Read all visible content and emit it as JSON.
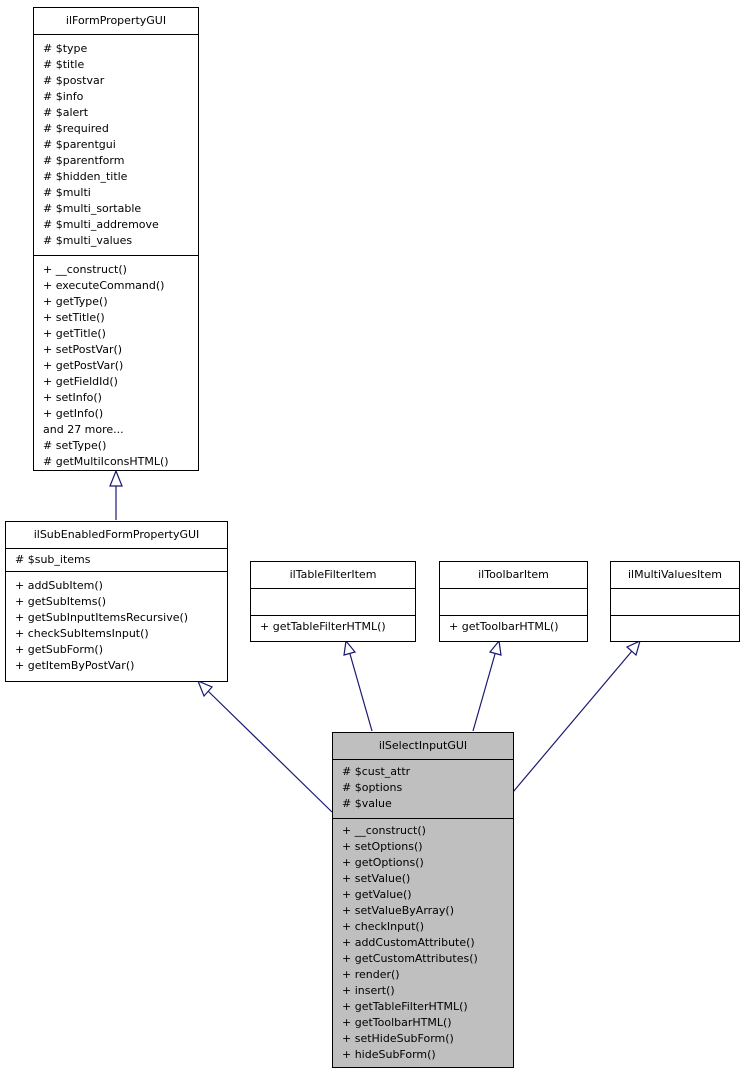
{
  "classes": {
    "form_property": {
      "name": "ilFormPropertyGUI",
      "attributes": [
        "# $type",
        "# $title",
        "# $postvar",
        "# $info",
        "# $alert",
        "# $required",
        "# $parentgui",
        "# $parentform",
        "# $hidden_title",
        "# $multi",
        "# $multi_sortable",
        "# $multi_addremove",
        "# $multi_values"
      ],
      "methods": [
        "+ __construct()",
        "+ executeCommand()",
        "+ getType()",
        "+ setTitle()",
        "+ getTitle()",
        "+ setPostVar()",
        "+ getPostVar()",
        "+ getFieldId()",
        "+ setInfo()",
        "+ getInfo()",
        "and 27 more...",
        "# setType()",
        "# getMultiIconsHTML()"
      ]
    },
    "sub_enabled": {
      "name": "ilSubEnabledFormPropertyGUI",
      "attributes": [
        "# $sub_items"
      ],
      "methods": [
        "+ addSubItem()",
        "+ getSubItems()",
        "+ getSubInputItemsRecursive()",
        "+ checkSubItemsInput()",
        "+ getSubForm()",
        "+ getItemByPostVar()"
      ]
    },
    "table_filter": {
      "name": "ilTableFilterItem",
      "attributes": [],
      "methods": [
        "+ getTableFilterHTML()"
      ]
    },
    "toolbar_item": {
      "name": "ilToolbarItem",
      "attributes": [],
      "methods": [
        "+ getToolbarHTML()"
      ]
    },
    "multi_values": {
      "name": "ilMultiValuesItem",
      "attributes": [],
      "methods": []
    },
    "select_input": {
      "name": "ilSelectInputGUI",
      "attributes": [
        "# $cust_attr",
        "# $options",
        "# $value"
      ],
      "methods": [
        "+ __construct()",
        "+ setOptions()",
        "+ getOptions()",
        "+ setValue()",
        "+ getValue()",
        "+ setValueByArray()",
        "+ checkInput()",
        "+ addCustomAttribute()",
        "+ getCustomAttributes()",
        "+ render()",
        "+ insert()",
        "+ getTableFilterHTML()",
        "+ getToolbarHTML()",
        "+ setHideSubForm()",
        "+ hideSubForm()"
      ]
    }
  },
  "edges": [
    {
      "from": "sub_enabled",
      "to": "form_property",
      "type": "inheritance"
    },
    {
      "from": "select_input",
      "to": "sub_enabled",
      "type": "inheritance"
    },
    {
      "from": "select_input",
      "to": "table_filter",
      "type": "inheritance"
    },
    {
      "from": "select_input",
      "to": "toolbar_item",
      "type": "inheritance"
    },
    {
      "from": "select_input",
      "to": "multi_values",
      "type": "inheritance"
    }
  ],
  "colors": {
    "edge": "#191970",
    "focus_fill": "#bfbfbf",
    "box_fill": "#ffffff",
    "border": "#000000"
  }
}
